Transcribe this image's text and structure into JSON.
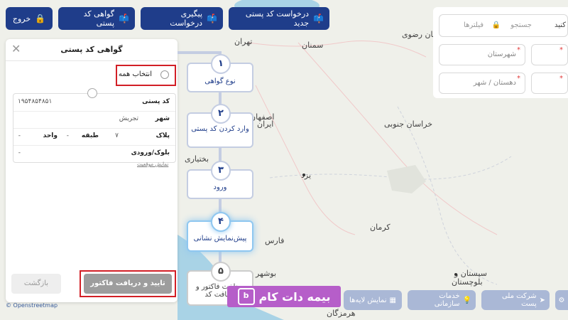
{
  "topbar": {
    "exit": "خروج",
    "postal_certificate": "گواهی کد پستی",
    "track_request": "پیگیری درخواست",
    "new_postal_request": "درخواست کد پستی جدید"
  },
  "filters": {
    "search": "جستجو",
    "filters_label": "فیلترها",
    "search_placeholder_partial": "کنید",
    "county": "شهرستان",
    "district_city": "دهستان / شهر"
  },
  "panel": {
    "title": "گواهی کد پستی",
    "select_all": "انتخاب همه",
    "postal_code_label": "کد پستی",
    "postal_code_value": "۱۹۵۴۸۵۴۸۵۱",
    "city_label": "شهر",
    "city_value": "تجریش",
    "plaque_label": "پلاک",
    "plaque_value": "۷",
    "floor_label": "طبقه",
    "floor_value": "-",
    "unit_label": "واحد",
    "unit_value": "-",
    "block_label": "بلوک/ورودی",
    "block_value": "-",
    "show_location": "نمایش موقعیت",
    "back": "بازگشت",
    "confirm": "تایید و دریافت فاکتور"
  },
  "steps": [
    {
      "num": "۱",
      "label": "نوع گواهی"
    },
    {
      "num": "۲",
      "label": "وارد کردن کد پستی"
    },
    {
      "num": "۳",
      "label": "ورود"
    },
    {
      "num": "۴",
      "label": "پیش‌نمایش نشانی"
    },
    {
      "num": "۵",
      "label": "پرداخت فاکتور و دریافت کد"
    }
  ],
  "bottombar": {
    "post_company": "شرکت ملی پست",
    "org_services": "خدمات سازمانی",
    "show_layers": "نمایش لایه‌ها"
  },
  "watermark": "بیمه دات کام",
  "map": {
    "cities": [
      "تهران",
      "سمنان",
      "خراسان رضوی",
      "اصفهان",
      "ایران",
      "بختیاری",
      "خراسان جنوبی",
      "یزد",
      "کرمان",
      "فارس",
      "بوشهر",
      "سیستان و",
      "بلوچستان",
      "هرمزگان"
    ],
    "attribution": "© Openstreetmap"
  },
  "colors": {
    "primary": "#1f3d8a",
    "highlight": "#d21f26",
    "secondary_btn": "#aab8d6"
  }
}
